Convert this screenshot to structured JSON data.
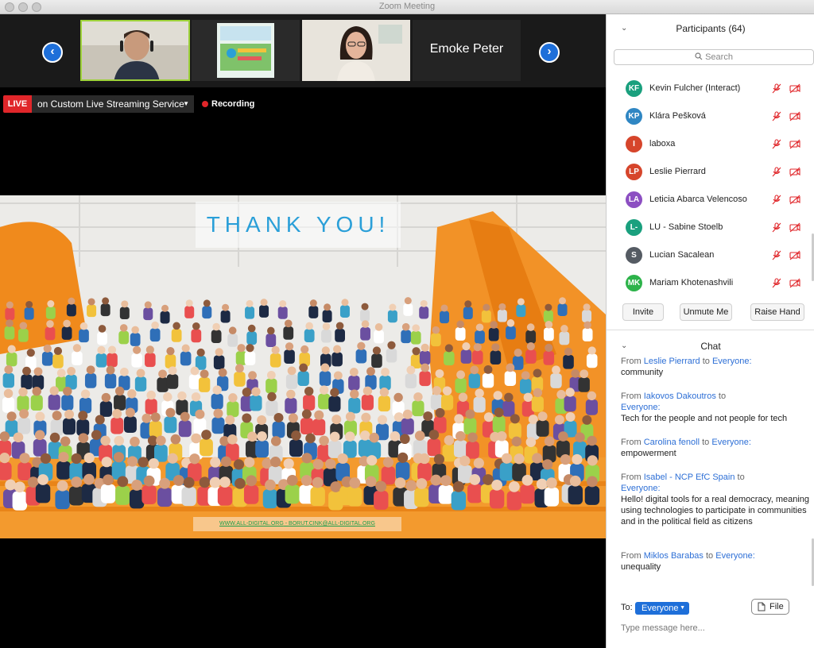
{
  "window": {
    "title": "Zoom Meeting"
  },
  "video_strip": {
    "prev_label": "‹",
    "next_label": "›",
    "tiles": [
      {
        "type": "video"
      },
      {
        "type": "video"
      },
      {
        "type": "video"
      },
      {
        "type": "name",
        "name": "Emoke Peter"
      }
    ]
  },
  "live": {
    "badge": "LIVE",
    "service": "on Custom Live Streaming Service",
    "recording": "Recording"
  },
  "slide": {
    "title": "THANK YOU!",
    "footer_link1": "WWW.ALL-DIGITAL.ORG",
    "footer_sep": " - ",
    "footer_link2": "BORUT.CINK@ALL-DIGITAL.ORG"
  },
  "participants": {
    "header": "Participants (64)",
    "search_placeholder": "Search",
    "list": [
      {
        "initials": "KF",
        "name": "Kevin Fulcher (Interact)",
        "color": "#1aa07e"
      },
      {
        "initials": "KP",
        "name": "Klára Pešková",
        "color": "#2f86c3"
      },
      {
        "initials": "I",
        "name": "laboxa",
        "color": "#d6452b"
      },
      {
        "initials": "LP",
        "name": "Leslie Pierrard",
        "color": "#d6452b"
      },
      {
        "initials": "LA",
        "name": "Leticia Abarca Velencoso",
        "color": "#8c4fc2"
      },
      {
        "initials": "L-",
        "name": "LU - Sabine Stoelb",
        "color": "#1aa07e"
      },
      {
        "initials": "S",
        "name": "Lucian Sacalean",
        "color": "#555b63"
      },
      {
        "initials": "MK",
        "name": "Mariam Khotenashvili",
        "color": "#2db34a"
      }
    ],
    "actions": {
      "invite": "Invite",
      "unmute": "Unmute Me",
      "raise_hand": "Raise Hand"
    }
  },
  "chat": {
    "header": "Chat",
    "messages": [
      {
        "from_prefix": "From",
        "sender": "Leslie Pierrard",
        "to_word": "to",
        "recipient": "Everyone:",
        "text": "community"
      },
      {
        "from_prefix": "From",
        "sender": "Iakovos Dakoutros",
        "to_word": "to",
        "recipient": "Everyone:",
        "text": "Tech for the people and not people for tech"
      },
      {
        "from_prefix": "From",
        "sender": "Carolina fenoll",
        "to_word": "to",
        "recipient": "Everyone:",
        "text": "empowerment"
      },
      {
        "from_prefix": "From",
        "sender": "Isabel - NCP EfC Spain",
        "to_word": "to",
        "recipient": "Everyone:",
        "text": "Hello! digital tools for a real democracy, meaning using technologies to participate in communities and in the political field as citizens"
      },
      {
        "from_prefix": "From",
        "sender": "Miklos Barabas",
        "to_word": "to",
        "recipient": "Everyone:",
        "text": "unequality"
      }
    ],
    "to_label": "To:",
    "to_value": "Everyone",
    "file_label": "File",
    "input_placeholder": "Type message here..."
  },
  "colors": {
    "accent": "#1e6fd9",
    "live": "#e0262a",
    "active_tile": "#9ed23a",
    "slide_orange": "#f08a1c"
  }
}
